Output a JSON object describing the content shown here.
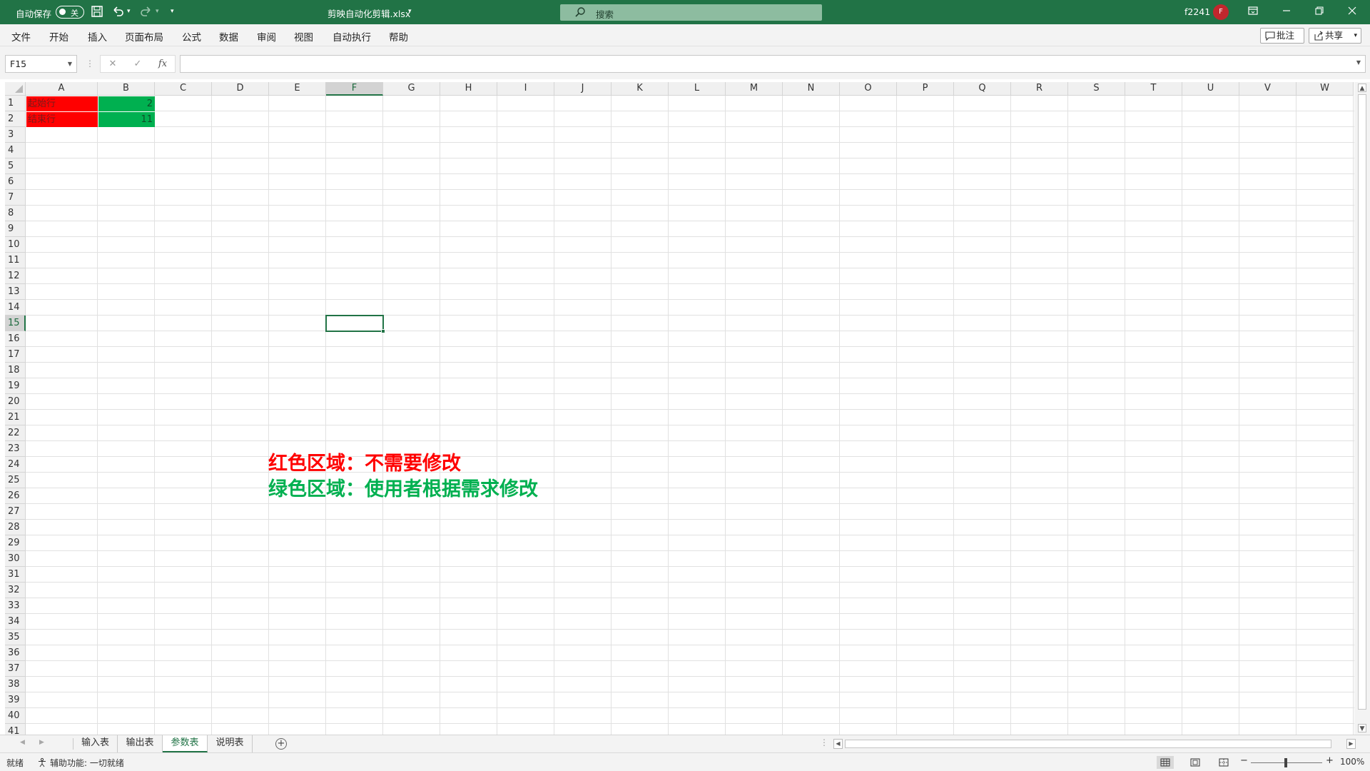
{
  "titlebar": {
    "autosave_label": "自动保存",
    "autosave_state": "关",
    "doc_title": "剪映自动化剪辑.xlsx",
    "search_placeholder": "搜索",
    "username": "f2241",
    "avatar_initial": "F",
    "accent_color": "#217346"
  },
  "menu": {
    "items": [
      "文件",
      "开始",
      "插入",
      "页面布局",
      "公式",
      "数据",
      "审阅",
      "视图",
      "自动执行",
      "帮助"
    ],
    "comments_label": "批注",
    "share_label": "共享"
  },
  "formula_bar": {
    "name_box": "F15",
    "cancel_glyph": "✕",
    "enter_glyph": "✓",
    "fx_glyph": "fx",
    "content": ""
  },
  "grid": {
    "columns": [
      "A",
      "B",
      "C",
      "D",
      "E",
      "F",
      "G",
      "H",
      "I",
      "J",
      "K",
      "L",
      "M",
      "N",
      "O",
      "P",
      "Q",
      "R",
      "S",
      "T",
      "U",
      "V",
      "W"
    ],
    "selected_column": "F",
    "selected_row": "15",
    "rows": [
      "1",
      "2",
      "3",
      "4",
      "5",
      "6",
      "7",
      "8",
      "9",
      "10",
      "11",
      "12",
      "13",
      "14",
      "15",
      "16",
      "17",
      "18",
      "19",
      "20",
      "21",
      "22",
      "23",
      "24",
      "25",
      "26",
      "27",
      "28",
      "29",
      "30",
      "31",
      "32",
      "33",
      "34",
      "35",
      "36",
      "37",
      "38",
      "39",
      "40",
      "41"
    ],
    "cells": {
      "A1": "起始行",
      "B1": "2",
      "A2": "结束行",
      "B2": "11"
    },
    "red_fill": "#ff0000",
    "green_fill": "#00b050"
  },
  "notes": {
    "red_note": "红色区域：不需要修改",
    "green_note": "绿色区域：使用者根据需求修改"
  },
  "sheets": {
    "tabs": [
      "输入表",
      "输出表",
      "参数表",
      "说明表"
    ],
    "active": "参数表"
  },
  "status": {
    "ready": "就绪",
    "accessibility": "辅助功能: 一切就绪",
    "zoom": "100%"
  }
}
